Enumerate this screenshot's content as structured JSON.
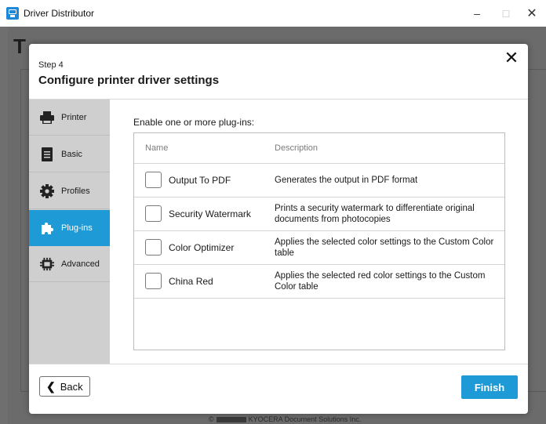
{
  "window": {
    "title": "Driver Distributor",
    "minimize": "–",
    "maximize": "□",
    "close": "✕"
  },
  "background": {
    "heading": "T",
    "footer": "KYOCERA Document Solutions Inc."
  },
  "dialog": {
    "step": "Step 4",
    "title": "Configure printer driver settings",
    "close": "✕",
    "sidebar": [
      {
        "label": "Printer",
        "icon": "printer-icon"
      },
      {
        "label": "Basic",
        "icon": "document-icon"
      },
      {
        "label": "Profiles",
        "icon": "gear-icon"
      },
      {
        "label": "Plug-ins",
        "icon": "puzzle-icon",
        "active": true
      },
      {
        "label": "Advanced",
        "icon": "chip-icon"
      }
    ],
    "content": {
      "instruction": "Enable one or more plug-ins:",
      "columns": [
        "Name",
        "Description"
      ],
      "plugins": [
        {
          "name": "Output To PDF",
          "description": "Generates the output in PDF format",
          "checked": false
        },
        {
          "name": "Security Watermark",
          "description": "Prints a security watermark to differentiate original documents from photocopies",
          "checked": false
        },
        {
          "name": "Color Optimizer",
          "description": "Applies the selected color settings to the Custom Color table",
          "checked": false
        },
        {
          "name": "China Red",
          "description": "Applies the selected red color settings to the Custom Color table",
          "checked": false
        }
      ]
    },
    "footer": {
      "back": "Back",
      "back_chevron": "❮",
      "finish": "Finish"
    }
  },
  "colors": {
    "accent": "#1e9ad6",
    "sidebar": "#cfcfcf"
  }
}
